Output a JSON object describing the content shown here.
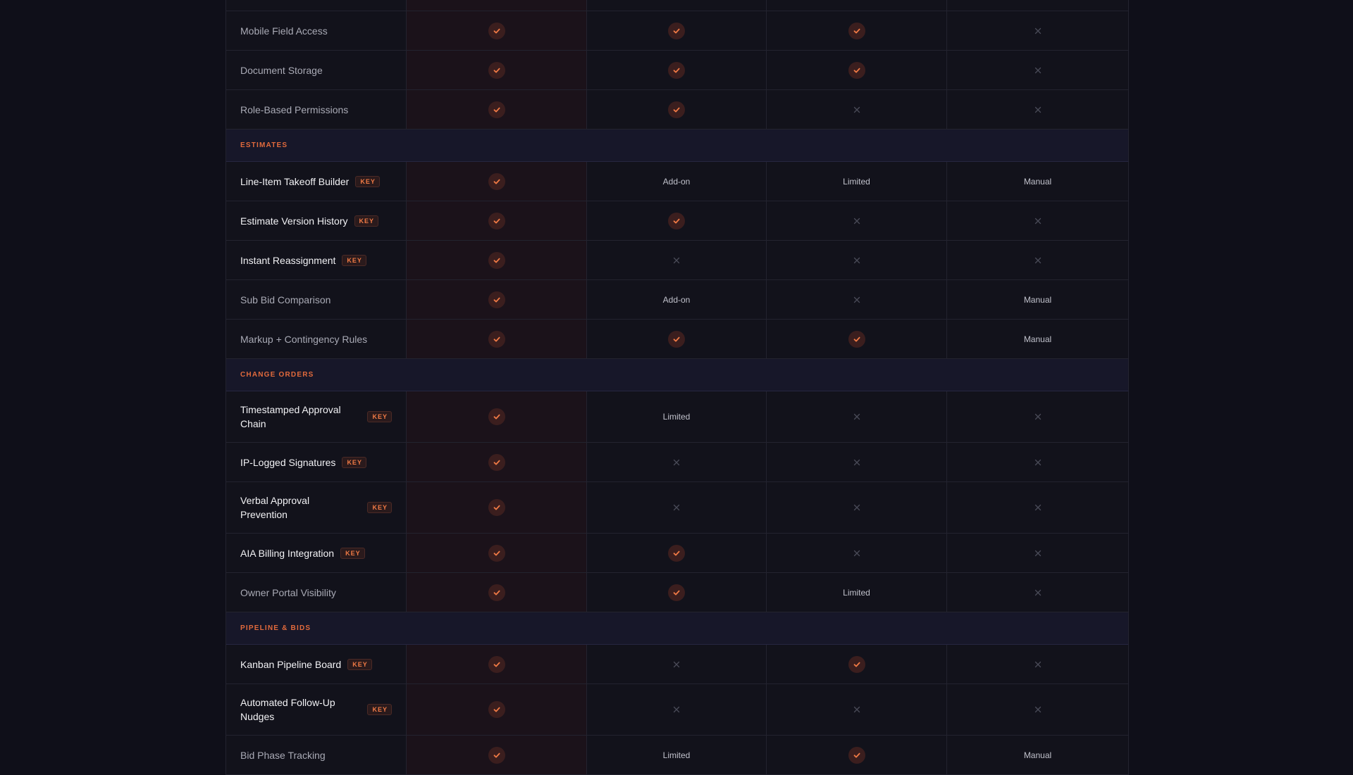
{
  "colors": {
    "accent": "#e26a3c",
    "check_bg": "#3b1e1e",
    "background": "#0f0f19"
  },
  "icons": {
    "yes": "check-icon",
    "no": "cross-icon"
  },
  "key_badge": "KEY",
  "sections": [
    {
      "title": "",
      "rows": [
        {
          "name": "Mobile Field Access",
          "key": false,
          "cells": [
            "yes",
            "yes",
            "yes",
            "no"
          ]
        },
        {
          "name": "Document Storage",
          "key": false,
          "cells": [
            "yes",
            "yes",
            "yes",
            "no"
          ]
        },
        {
          "name": "Role-Based Permissions",
          "key": false,
          "cells": [
            "yes",
            "yes",
            "no",
            "no"
          ]
        }
      ]
    },
    {
      "title": "ESTIMATES",
      "rows": [
        {
          "name": "Line-Item Takeoff Builder",
          "key": true,
          "cells": [
            "yes",
            "Add-on",
            "Limited",
            "Manual"
          ]
        },
        {
          "name": "Estimate Version History",
          "key": true,
          "cells": [
            "yes",
            "yes",
            "no",
            "no"
          ]
        },
        {
          "name": "Instant Reassignment",
          "key": true,
          "cells": [
            "yes",
            "no",
            "no",
            "no"
          ]
        },
        {
          "name": "Sub Bid Comparison",
          "key": false,
          "cells": [
            "yes",
            "Add-on",
            "no",
            "Manual"
          ]
        },
        {
          "name": "Markup + Contingency Rules",
          "key": false,
          "cells": [
            "yes",
            "yes",
            "yes",
            "Manual"
          ]
        }
      ]
    },
    {
      "title": "CHANGE ORDERS",
      "rows": [
        {
          "name": "Timestamped Approval Chain",
          "key": true,
          "cells": [
            "yes",
            "Limited",
            "no",
            "no"
          ]
        },
        {
          "name": "IP-Logged Signatures",
          "key": true,
          "cells": [
            "yes",
            "no",
            "no",
            "no"
          ]
        },
        {
          "name": "Verbal Approval Prevention",
          "key": true,
          "cells": [
            "yes",
            "no",
            "no",
            "no"
          ]
        },
        {
          "name": "AIA Billing Integration",
          "key": true,
          "cells": [
            "yes",
            "yes",
            "no",
            "no"
          ]
        },
        {
          "name": "Owner Portal Visibility",
          "key": false,
          "cells": [
            "yes",
            "yes",
            "Limited",
            "no"
          ]
        }
      ]
    },
    {
      "title": "PIPELINE & BIDS",
      "rows": [
        {
          "name": "Kanban Pipeline Board",
          "key": true,
          "cells": [
            "yes",
            "no",
            "yes",
            "no"
          ]
        },
        {
          "name": "Automated Follow-Up Nudges",
          "key": true,
          "cells": [
            "yes",
            "no",
            "no",
            "no"
          ]
        },
        {
          "name": "Bid Phase Tracking",
          "key": false,
          "cells": [
            "yes",
            "Limited",
            "yes",
            "Manual"
          ]
        }
      ]
    }
  ]
}
